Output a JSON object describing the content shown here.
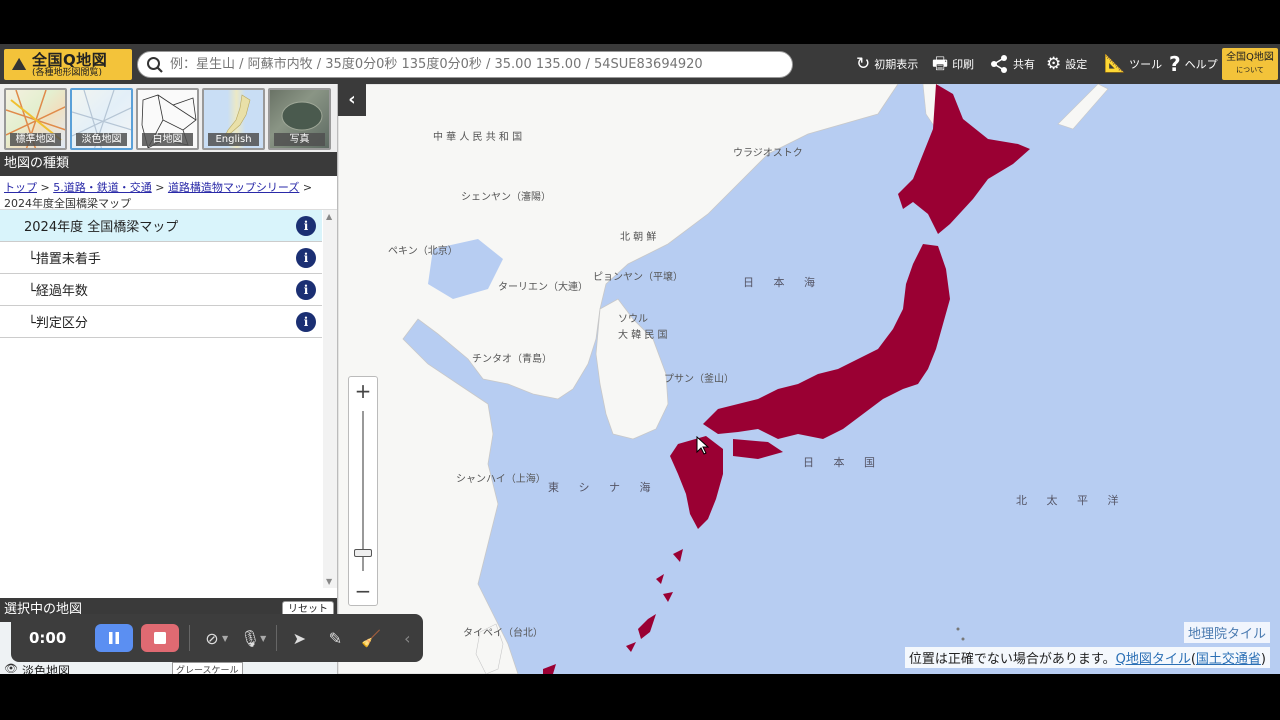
{
  "header": {
    "logo_title": "全国Q地図",
    "logo_sub": "(各種地形図閲覧)",
    "search_placeholder": "例：星生山 / 阿蘇市内牧 / 35度0分0秒 135度0分0秒 / 35.00 135.00 / 54SUE83694920",
    "buttons": {
      "initial_view": "初期表示",
      "print": "印刷",
      "share": "共有",
      "settings": "設定",
      "tools": "ツール",
      "help": "ヘルプ"
    },
    "about_line1": "全国Q地図",
    "about_line2": "について"
  },
  "sidebar": {
    "thumbs": [
      {
        "label": "標準地図"
      },
      {
        "label": "淡色地図"
      },
      {
        "label": "白地図"
      },
      {
        "label": "English"
      },
      {
        "label": "写真"
      }
    ],
    "section_title": "地図の種類",
    "breadcrumb": {
      "top": "トップ",
      "sep": " > ",
      "l1": "5.道路・鉄道・交通",
      "l2": "道路構造物マップシリーズ",
      "current": "2024年度全国橋梁マップ"
    },
    "layers": [
      {
        "label": "2024年度 全国橋梁マップ"
      },
      {
        "label": "└措置未着手"
      },
      {
        "label": "└経過年数"
      },
      {
        "label": "└判定区分"
      }
    ],
    "selected_title": "選択中の地図",
    "reset_label": "リセット",
    "selected_item": "淡色地図",
    "grayscale_label": "グレースケール"
  },
  "map": {
    "labels": {
      "china": "中 華 人 民 共 和 国",
      "vladivostok": "ウラジオストク",
      "shenyang": "シェンヤン（瀋陽）",
      "beijing": "ペキン（北京）",
      "north_korea": "北 朝 鮮",
      "pyongyang": "ピョンヤン（平壌）",
      "dalian": "ターリエン（大連）",
      "seoul": "ソウル",
      "south_korea": "大 韓 民 国",
      "qingdao": "チンタオ（青島）",
      "busan": "プサン（釜山）",
      "sea_of_japan": "日 本 海",
      "japan": "日 本 国",
      "shanghai": "シャンハイ（上海）",
      "east_china_sea": "東 シ ナ 海",
      "north_pacific": "北 太 平 洋",
      "taipei": "タイペイ（台北）"
    },
    "attribution_tile": "地理院タイル",
    "note_text": "位置は正確でない場合があります。",
    "note_link1": "Q地図タイル",
    "note_link2": "国土交通省",
    "overlay_color": "#9a0033",
    "sea_color": "#b7cdf2"
  },
  "recorder": {
    "time": "0:00"
  }
}
